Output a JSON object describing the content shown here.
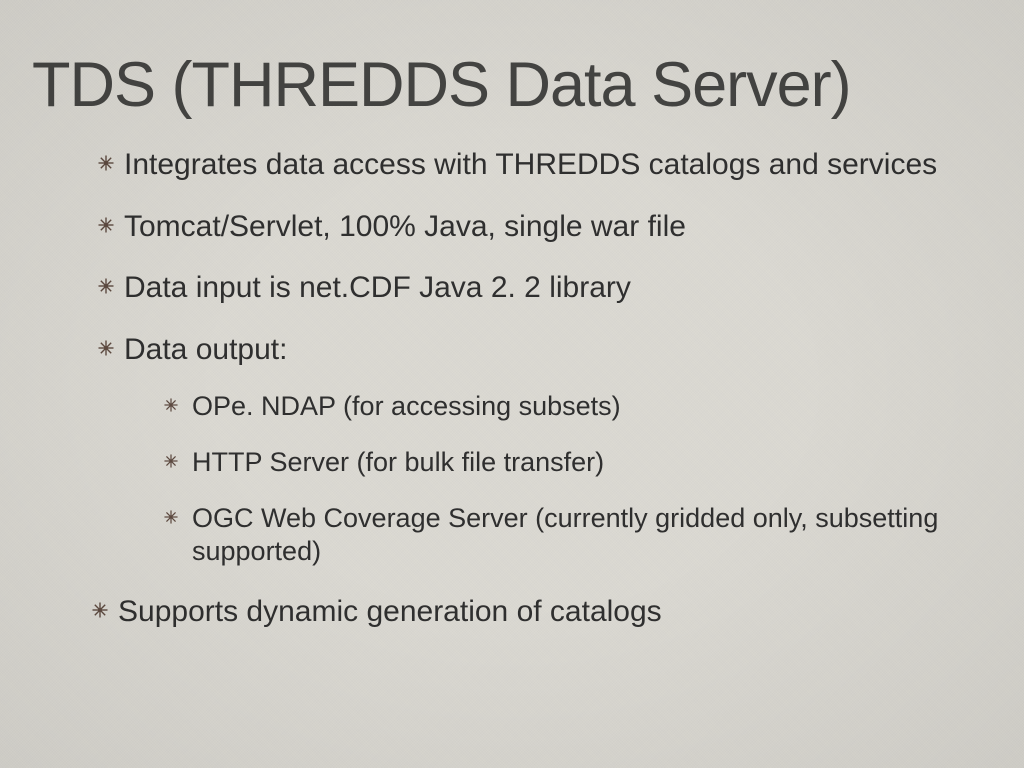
{
  "title": "TDS (THREDDS Data Server)",
  "items": [
    {
      "text": "Integrates data access with THREDDS catalogs and services"
    },
    {
      "text": "Tomcat/Servlet, 100% Java, single war file"
    },
    {
      "text": "Data input is net.CDF Java 2. 2 library"
    },
    {
      "text": "Data output:",
      "children": [
        {
          "text": "OPe. NDAP  (for accessing subsets)"
        },
        {
          "text": "HTTP Server (for bulk file transfer)"
        },
        {
          "text": "OGC Web Coverage Server (currently gridded only, subsetting supported)"
        }
      ]
    },
    {
      "text": "Supports dynamic generation of catalogs"
    }
  ],
  "bullet_color": "#6b5042"
}
